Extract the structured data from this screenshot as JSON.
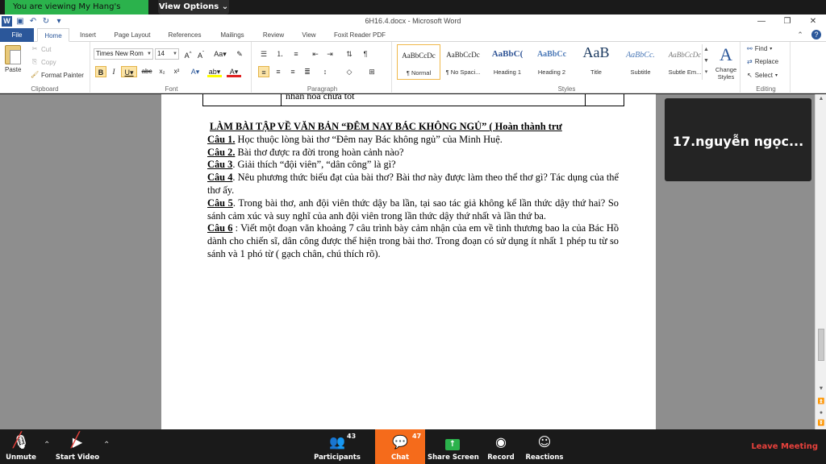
{
  "zoom_top": {
    "viewing_banner": "You are viewing  My Hang's screen",
    "view_options": "View Options ⌄"
  },
  "word": {
    "title": "6H16.4.docx - Microsoft Word",
    "tabs": [
      "File",
      "Home",
      "Insert",
      "Page Layout",
      "References",
      "Mailings",
      "Review",
      "View",
      "Foxit Reader PDF"
    ],
    "active_tab": "Home",
    "clipboard": {
      "paste": "Paste",
      "cut": "Cut",
      "copy": "Copy",
      "format_painter": "Format Painter",
      "label": "Clipboard"
    },
    "font": {
      "family": "Times New Rom",
      "size": "14",
      "label": "Font"
    },
    "paragraph": {
      "label": "Paragraph"
    },
    "styles": {
      "label": "Styles",
      "items": [
        {
          "sample": "AaBbCcDc",
          "name": "¶ Normal"
        },
        {
          "sample": "AaBbCcDc",
          "name": "¶ No Spaci..."
        },
        {
          "sample": "AaBbC(",
          "name": "Heading 1"
        },
        {
          "sample": "AaBbCc",
          "name": "Heading 2"
        },
        {
          "sample": "AaB",
          "name": "Title"
        },
        {
          "sample": "AaBbCc.",
          "name": "Subtitle"
        },
        {
          "sample": "AaBbCcDc",
          "name": "Subtle Em..."
        }
      ],
      "change_styles": "Change Styles"
    },
    "editing": {
      "find": "Find",
      "replace": "Replace",
      "select": "Select",
      "label": "Editing"
    }
  },
  "document": {
    "prev_table_text": "nhân hoá chưa tốt",
    "heading": "LÀM BÀI TẬP VỀ VĂN BẢN “ĐÊM  NAY BÁC KHÔNG NGỦ” ( Hoàn thành trư",
    "questions": [
      {
        "label": "Câu 1.",
        "text": " Học thuộc lòng bài thơ “Đêm nay Bác không ngủ” của Minh Huệ."
      },
      {
        "label": "Câu 2.",
        "text": " Bài thơ được ra đời trong hoàn cảnh nào?"
      },
      {
        "label": "Câu 3",
        "text": ". Giải thích “đội viên”, “dân công” là gì?"
      },
      {
        "label": "Câu 4",
        "text": ". Nêu phương thức biểu đạt của bài thơ? Bài thơ này được làm theo thể thơ gì? Tác dụng của thể thơ ấy."
      },
      {
        "label": "Câu 5",
        "text": ". Trong bài thơ, anh đội viên thức dậy ba lần, tại sao tác giả không kể lần thức dậy thứ hai? So sánh cảm xúc và suy nghĩ của anh đội viên trong lần thức dậy thứ nhất và lần thứ ba."
      },
      {
        "label": "Câu 6",
        "text": " : Viết một đoạn văn khoảng 7 câu trình bày cảm nhận của em về tình thương bao la của Bác Hồ dành cho chiến sĩ, dân công được thể hiện trong bài thơ. Trong đoạn có sử dụng ít nhất 1 phép tu từ so sánh và 1 phó từ ( gạch chân, chú thích rõ)."
      }
    ]
  },
  "participant": {
    "name": "17.nguyễn  ngọc..."
  },
  "zoom_bar": {
    "unmute": "Unmute",
    "start_video": "Start Video",
    "participants": "Participants",
    "participants_count": "43",
    "chat": "Chat",
    "chat_count": "47",
    "share_screen": "Share Screen",
    "record": "Record",
    "reactions": "Reactions",
    "leave": "Leave Meeting"
  }
}
